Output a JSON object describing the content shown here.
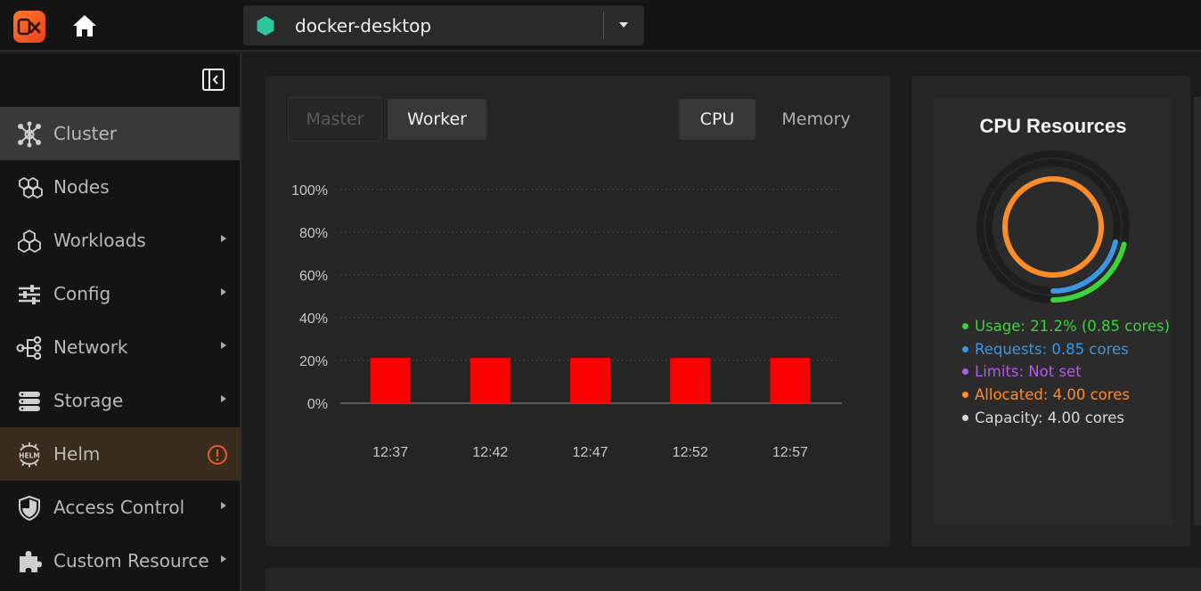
{
  "header": {
    "cluster_name": "docker-desktop",
    "colors": {
      "logo": "#ff6a24",
      "cluster_dot": "#2ec4a0"
    },
    "icons": {
      "logo": "app-logo-icon",
      "home": "home-icon",
      "caret": "caret-down-icon"
    }
  },
  "sidebar": {
    "items": [
      {
        "label": "Cluster",
        "icon": "cluster-icon",
        "active": true,
        "has_arrow": false
      },
      {
        "label": "Nodes",
        "icon": "nodes-icon",
        "has_arrow": false
      },
      {
        "label": "Workloads",
        "icon": "workloads-icon",
        "has_arrow": true
      },
      {
        "label": "Config",
        "icon": "config-icon",
        "has_arrow": true
      },
      {
        "label": "Network",
        "icon": "network-icon",
        "has_arrow": true
      },
      {
        "label": "Storage",
        "icon": "storage-icon",
        "has_arrow": true
      },
      {
        "label": "Helm",
        "icon": "helm-icon",
        "has_arrow": false,
        "alert": true
      },
      {
        "label": "Access Control",
        "icon": "shield-icon",
        "has_arrow": true
      },
      {
        "label": "Custom Resource",
        "icon": "puzzle-icon",
        "has_arrow": true
      }
    ]
  },
  "chart_panel": {
    "node_tabs": {
      "master": "Master",
      "worker": "Worker",
      "selected": "Worker"
    },
    "metric_tabs": {
      "cpu": "CPU",
      "memory": "Memory",
      "selected": "CPU"
    }
  },
  "chart_data": {
    "type": "bar",
    "categories": [
      "12:37",
      "12:42",
      "12:47",
      "12:52",
      "12:57"
    ],
    "values": [
      21.2,
      21.2,
      21.2,
      21.2,
      21.2
    ],
    "ylim": [
      0,
      100
    ],
    "yticks": [
      "0%",
      "20%",
      "40%",
      "60%",
      "80%",
      "100%"
    ],
    "bar_color": "#ff0000",
    "grid": true
  },
  "cpu_resources": {
    "title": "CPU Resources",
    "legend": [
      {
        "text": "Usage: 21.2% (0.85 cores)",
        "color": "#3fd23f"
      },
      {
        "text": "Requests: 0.85 cores",
        "color": "#3d96e0"
      },
      {
        "text": "Limits: Not set",
        "color": "#b45ce6"
      },
      {
        "text": "Allocated: 4.00 cores",
        "color": "#ff8c2a"
      },
      {
        "text": "Capacity: 4.00 cores",
        "color": "#d8d8d8"
      }
    ],
    "gauge": {
      "usage_fraction": 0.212,
      "requests_fraction": 0.2125,
      "allocated_fraction": 1.0
    }
  }
}
